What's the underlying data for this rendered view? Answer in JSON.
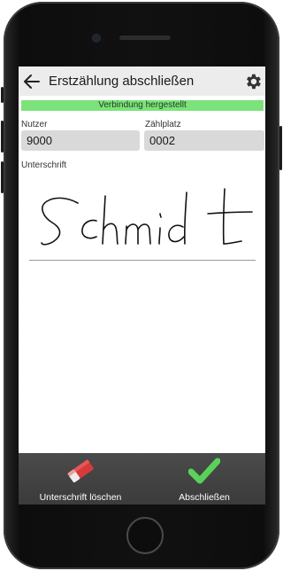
{
  "appbar": {
    "title": "Erstzählung abschließen",
    "back_icon": "arrow-left-icon",
    "settings_icon": "gear-icon"
  },
  "status": {
    "text": "Verbindung hergestellt",
    "color": "#7ce27a"
  },
  "fields": {
    "nutzer": {
      "label": "Nutzer",
      "value": "9000"
    },
    "zaehlplatz": {
      "label": "Zählplatz",
      "value": "0002"
    }
  },
  "signature": {
    "label": "Unterschrift",
    "handwritten_text": "Schmidt"
  },
  "toolbar": {
    "clear": {
      "label": "Unterschrift löschen",
      "icon": "eraser-icon"
    },
    "finish": {
      "label": "Abschließen",
      "icon": "checkmark-icon",
      "color": "#59d25a"
    }
  }
}
